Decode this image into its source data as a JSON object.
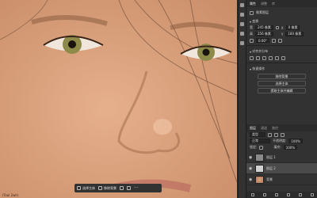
{
  "canvas": {
    "status_text": "(Tool 2wh)"
  },
  "context_bar": {
    "items": [
      {
        "label": "选择主体",
        "icon": "subject-select-icon"
      },
      {
        "label": "移除背景",
        "icon": "remove-background-icon"
      }
    ]
  },
  "panel": {
    "tabs": [
      "属性",
      "调整",
      "库"
    ],
    "doc_label": "像素图层",
    "sections": {
      "transform": "变换",
      "align": "对齐并分布",
      "quick_actions": "快速操作"
    },
    "transform": {
      "w_label": "宽",
      "w_value": "245 像素",
      "h_label": "高",
      "h_value": "256 像素",
      "x_label": "X",
      "x_value": "0 像素",
      "y_label": "Y",
      "y_value": "180 像素",
      "angle": "0.00°"
    },
    "quick_actions": [
      "移除背景",
      "选择主体",
      "提取主体并编辑"
    ]
  },
  "layers": {
    "tabs": [
      "图层",
      "通道",
      "路径"
    ],
    "filter_label": "类型",
    "blend_mode": "正常",
    "opacity_label": "不透明度:",
    "opacity_value": "100%",
    "lock_label": "锁定:",
    "fill_label": "填充:",
    "fill_value": "100%",
    "items": [
      {
        "name": "图层 1",
        "thumb": "grey"
      },
      {
        "name": "图层 2",
        "thumb": "light"
      },
      {
        "name": "背景",
        "thumb": "face"
      }
    ]
  }
}
